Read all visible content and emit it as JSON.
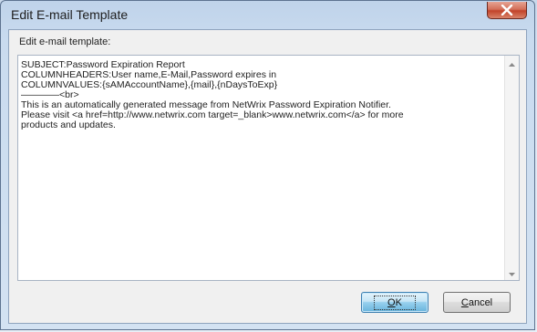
{
  "window": {
    "title": "Edit E-mail Template"
  },
  "editor": {
    "label": "Edit e-mail template:",
    "content": "SUBJECT:Password Expiration Report\nCOLUMNHEADERS:User name,E-Mail,Password expires in\nCOLUMNVALUES:{sAMAccountName},{mail},{nDaysToExp}\n————<br>\nThis is an automatically generated message from NetWrix Password Expiration Notifier.\nPlease visit <a href=http://www.netwrix.com target=_blank>www.netwrix.com</a> for more\nproducts and updates."
  },
  "buttons": {
    "ok_first": "O",
    "ok_rest": "K",
    "cancel_first": "C",
    "cancel_rest": "ancel"
  },
  "icons": {
    "close": "close-icon",
    "scroll_up": "scroll-up-arrow-icon",
    "scroll_down": "scroll-down-arrow-icon"
  },
  "colors": {
    "close_button": "#c2432a",
    "default_button": "#68b3db",
    "title_bar": "#bfd3ea"
  }
}
